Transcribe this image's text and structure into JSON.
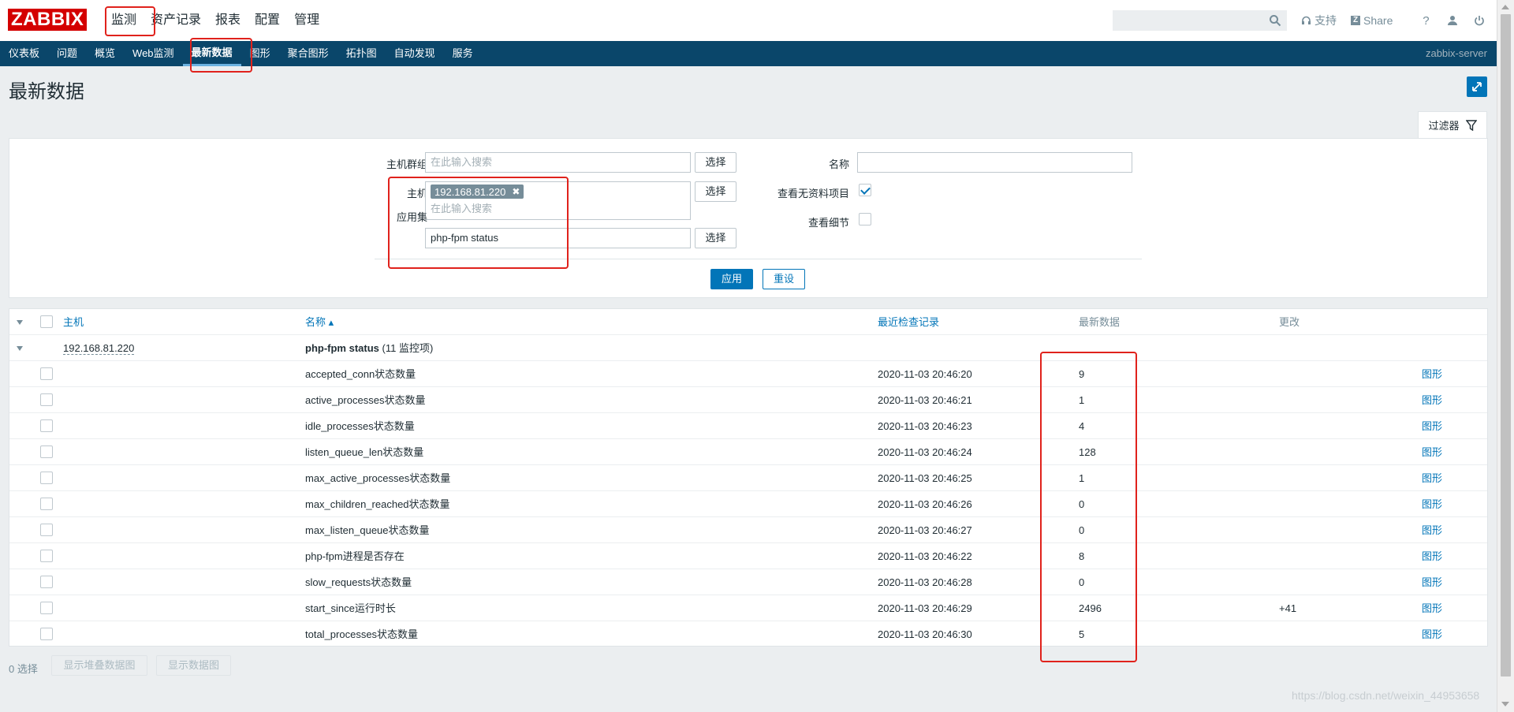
{
  "app": {
    "logo_text": "ZABBIX",
    "server_name": "zabbix-server",
    "brand_color": "#d40000",
    "nav_color": "#0a466a",
    "accent_color": "#0275b8"
  },
  "main_menu": [
    "监测",
    "资产记录",
    "报表",
    "配置",
    "管理"
  ],
  "top_links": {
    "support": "支持",
    "share": "Share",
    "help": "?"
  },
  "sub_menu": [
    "仪表板",
    "问题",
    "概览",
    "Web监测",
    "最新数据",
    "图形",
    "聚合图形",
    "拓扑图",
    "自动发现",
    "服务"
  ],
  "sub_menu_active": "最新数据",
  "page": {
    "title": "最新数据"
  },
  "filter": {
    "tab_label": "过滤器",
    "host_groups_label": "主机群组",
    "host_groups_placeholder": "在此输入搜索",
    "hosts_label": "主机",
    "host_chip": "192.168.81.220",
    "hosts_placeholder": "在此输入搜索",
    "application_label": "应用集",
    "application_value": "php-fpm status",
    "select_button": "选择",
    "name_label": "名称",
    "name_value": "",
    "show_without_data_label": "查看无资料项目",
    "show_without_data_checked": true,
    "show_details_label": "查看细节",
    "show_details_checked": false,
    "apply_button": "应用",
    "reset_button": "重设"
  },
  "table": {
    "headers": {
      "host": "主机",
      "name": "名称 ▴",
      "last_check": "最近检查记录",
      "last_value": "最新数据",
      "change": "更改"
    },
    "group": {
      "host": "192.168.81.220",
      "app_name": "php-fpm status",
      "app_count": "(11 监控项)"
    },
    "graph_link": "图形",
    "rows": [
      {
        "name": "accepted_conn状态数量",
        "last_check": "2020-11-03 20:46:20",
        "last_value": "9",
        "change": ""
      },
      {
        "name": "active_processes状态数量",
        "last_check": "2020-11-03 20:46:21",
        "last_value": "1",
        "change": ""
      },
      {
        "name": "idle_processes状态数量",
        "last_check": "2020-11-03 20:46:23",
        "last_value": "4",
        "change": ""
      },
      {
        "name": "listen_queue_len状态数量",
        "last_check": "2020-11-03 20:46:24",
        "last_value": "128",
        "change": ""
      },
      {
        "name": "max_active_processes状态数量",
        "last_check": "2020-11-03 20:46:25",
        "last_value": "1",
        "change": ""
      },
      {
        "name": "max_children_reached状态数量",
        "last_check": "2020-11-03 20:46:26",
        "last_value": "0",
        "change": ""
      },
      {
        "name": "max_listen_queue状态数量",
        "last_check": "2020-11-03 20:46:27",
        "last_value": "0",
        "change": ""
      },
      {
        "name": "php-fpm进程是否存在",
        "last_check": "2020-11-03 20:46:22",
        "last_value": "8",
        "change": ""
      },
      {
        "name": "slow_requests状态数量",
        "last_check": "2020-11-03 20:46:28",
        "last_value": "0",
        "change": ""
      },
      {
        "name": "start_since运行时长",
        "last_check": "2020-11-03 20:46:29",
        "last_value": "2496",
        "change": "+41"
      },
      {
        "name": "total_processes状态数量",
        "last_check": "2020-11-03 20:46:30",
        "last_value": "5",
        "change": ""
      }
    ]
  },
  "footer": {
    "selected_count": "0 选择",
    "stacked_graph_button": "显示堆叠数据图",
    "graph_button": "显示数据图"
  },
  "watermark": "https://blog.csdn.net/weixin_44953658"
}
